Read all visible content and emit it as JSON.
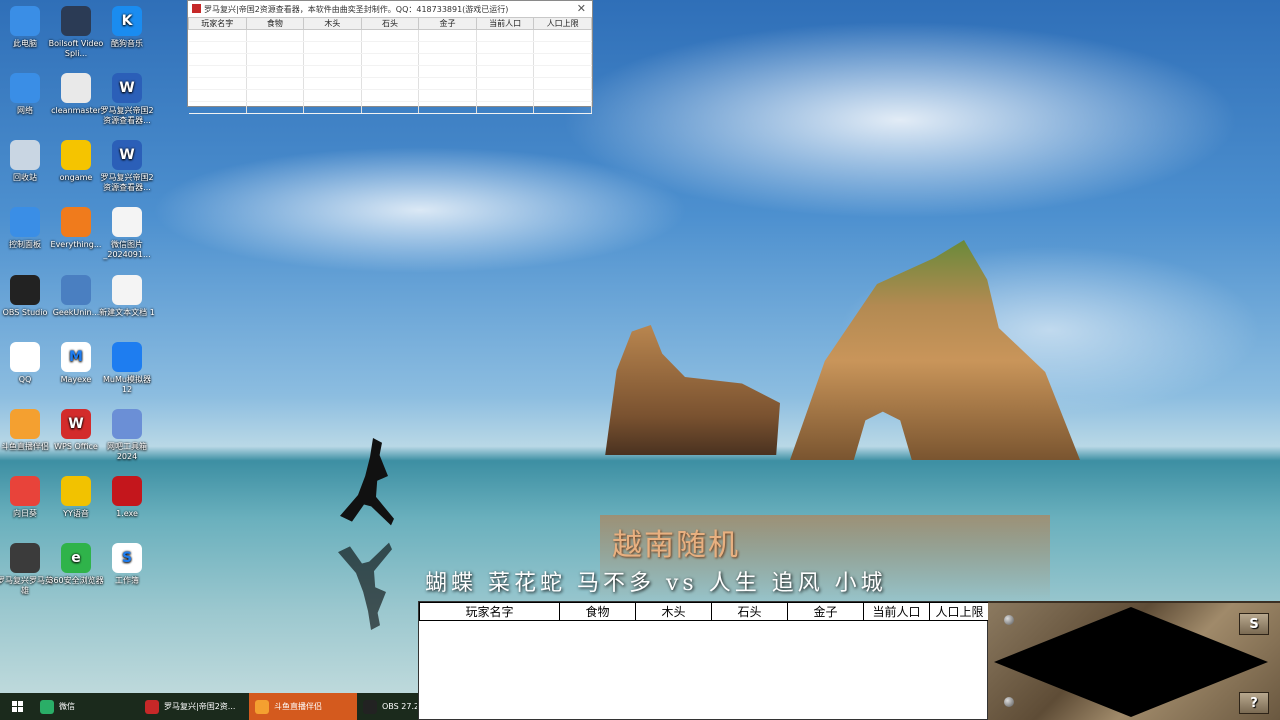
{
  "desktop": {
    "icons": [
      {
        "label": "此电脑",
        "icon": "computer-icon",
        "color": "#3a8ee6",
        "glyph": ""
      },
      {
        "label": "Boilsoft Video Spli...",
        "icon": "video-splitter-icon",
        "color": "#2b3b55",
        "glyph": ""
      },
      {
        "label": "酷狗音乐",
        "icon": "kugou-music-icon",
        "color": "#1a8cf0",
        "glyph": "K"
      },
      {
        "label": "网络",
        "icon": "network-icon",
        "color": "#3a8ee6",
        "glyph": ""
      },
      {
        "label": "cleanmaster",
        "icon": "cleanmaster-icon",
        "color": "#e9e9e9",
        "glyph": ""
      },
      {
        "label": "罗马复兴帝国2资源查看器...",
        "icon": "word-doc-icon",
        "color": "#2b5fb8",
        "glyph": "W"
      },
      {
        "label": "回收站",
        "icon": "recycle-bin-icon",
        "color": "#c9d6e3",
        "glyph": ""
      },
      {
        "label": "ongame",
        "icon": "ongame-icon",
        "color": "#f5c400",
        "glyph": ""
      },
      {
        "label": "罗马复兴帝国2资源查看器...",
        "icon": "word-doc-icon",
        "color": "#2b5fb8",
        "glyph": "W"
      },
      {
        "label": "控制面板",
        "icon": "control-panel-icon",
        "color": "#3a8ee6",
        "glyph": ""
      },
      {
        "label": "Everything...",
        "icon": "everything-search-icon",
        "color": "#f07b1c",
        "glyph": ""
      },
      {
        "label": "微信图片_2024091...",
        "icon": "image-file-icon",
        "color": "#f4f4f4",
        "glyph": ""
      },
      {
        "label": "OBS Studio",
        "icon": "obs-icon",
        "color": "#222222",
        "glyph": ""
      },
      {
        "label": "GeekUnin...",
        "icon": "geek-uninstaller-icon",
        "color": "#4a7fc1",
        "glyph": ""
      },
      {
        "label": "新建文本文档 1",
        "icon": "text-file-icon",
        "color": "#f4f4f4",
        "glyph": ""
      },
      {
        "label": "QQ",
        "icon": "qq-icon",
        "color": "#ffffff",
        "glyph": ""
      },
      {
        "label": "Mayexe",
        "icon": "maye-icon",
        "color": "#ffffff",
        "glyph": "M"
      },
      {
        "label": "MuMu模拟器12",
        "icon": "mumu-icon",
        "color": "#1e7df0",
        "glyph": ""
      },
      {
        "label": "斗鱼直播伴侣",
        "icon": "douyu-icon",
        "color": "#f4a030",
        "glyph": ""
      },
      {
        "label": "WPS Office",
        "icon": "wps-icon",
        "color": "#d32b2b",
        "glyph": "W"
      },
      {
        "label": "网吧工具箱 2024",
        "icon": "toolbox-icon",
        "color": "#6b8fd6",
        "glyph": ""
      },
      {
        "label": "向日葵",
        "icon": "sunlogin-icon",
        "color": "#e8433a",
        "glyph": ""
      },
      {
        "label": "YY语音",
        "icon": "yy-icon",
        "color": "#f2c200",
        "glyph": ""
      },
      {
        "label": "1.exe",
        "icon": "exe-icon",
        "color": "#c4161c",
        "glyph": ""
      },
      {
        "label": "罗马复兴罗马英雄",
        "icon": "game-shortcut-icon",
        "color": "#3b3b3b",
        "glyph": ""
      },
      {
        "label": "360安全浏览器",
        "icon": "360-browser-icon",
        "color": "#2fb34a",
        "glyph": "e"
      },
      {
        "label": "工作簿",
        "icon": "spreadsheet-icon",
        "color": "#ffffff",
        "glyph": "S"
      }
    ]
  },
  "mini_window": {
    "title": "罗马复兴|帝国2资源查看器，本软件由曲奕圣封制作。QQ：418733891(游戏已运行)",
    "close_glyph": "✕",
    "columns": [
      "玩家名字",
      "食物",
      "木头",
      "石头",
      "金子",
      "当前人口",
      "人口上限"
    ]
  },
  "overlay": {
    "title": "越南随机",
    "players": "蝴蝶 菜花蛇 马不多 vs 人生 追风 小城"
  },
  "stats_table": {
    "columns": [
      "玩家名字",
      "食物",
      "木头",
      "石头",
      "金子",
      "当前人口",
      "人口上限"
    ]
  },
  "minimap": {
    "button_top": "S",
    "button_bottom": "?"
  },
  "taskbar": {
    "items": [
      {
        "label": "微信",
        "icon": "wechat-icon",
        "color": "#2aae67",
        "active": false
      },
      {
        "label": "罗马复兴|帝国2资...",
        "icon": "rome-app-icon",
        "color": "#c62828",
        "active": false
      },
      {
        "label": "斗鱼直播伴侣",
        "icon": "douyu-icon",
        "color": "#f4a030",
        "active": true
      },
      {
        "label": "OBS 27.2.",
        "icon": "obs-icon",
        "color": "#222222",
        "active": false
      }
    ]
  }
}
